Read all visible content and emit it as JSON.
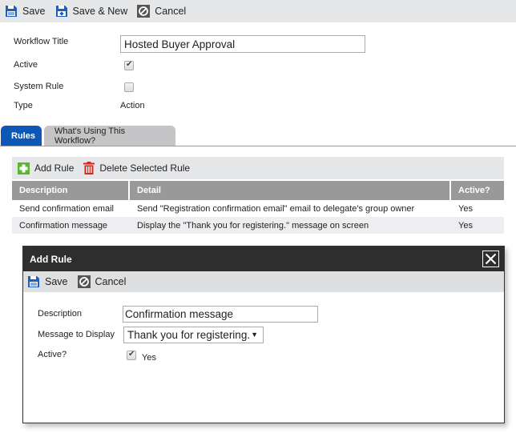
{
  "toolbar": {
    "save_label": "Save",
    "save_new_label": "Save & New",
    "cancel_label": "Cancel"
  },
  "form": {
    "workflow_title_label": "Workflow Title",
    "workflow_title_value": "Hosted Buyer Approval",
    "active_label": "Active",
    "active_checked": true,
    "system_rule_label": "System Rule",
    "system_rule_checked": false,
    "type_label": "Type",
    "type_value": "Action"
  },
  "tabs": [
    {
      "label": "Rules",
      "active": true
    },
    {
      "label": "What's Using This Workflow?",
      "active": false
    }
  ],
  "rules_toolbar": {
    "add_label": "Add Rule",
    "delete_label": "Delete Selected Rule"
  },
  "rules_table": {
    "columns": [
      "Description",
      "Detail",
      "Active?"
    ],
    "rows": [
      {
        "description": "Send confirmation email",
        "detail": "Send \"Registration confirmation email\" email to delegate's group owner",
        "active": "Yes"
      },
      {
        "description": "Confirmation message",
        "detail": "Display the \"Thank you for registering.\" message on screen",
        "active": "Yes"
      }
    ]
  },
  "modal": {
    "title": "Add Rule",
    "save_label": "Save",
    "cancel_label": "Cancel",
    "description_label": "Description",
    "description_value": "Confirmation message",
    "message_label": "Message to Display",
    "message_value": "Thank you for registering.",
    "active_label": "Active?",
    "active_checked": true,
    "active_option_label": "Yes"
  },
  "colors": {
    "accent_blue": "#0d58b6",
    "add_green": "#5cb531",
    "delete_red": "#d9261c",
    "modal_header": "#2e2e2e",
    "table_header": "#999999"
  }
}
